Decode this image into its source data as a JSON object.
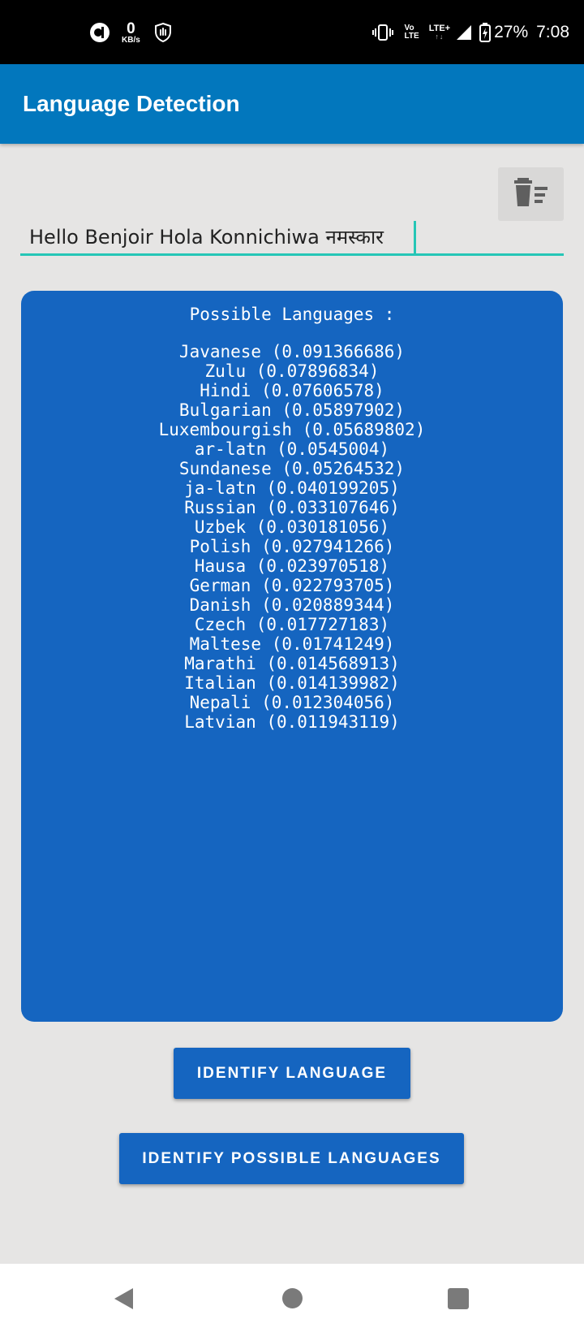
{
  "status_bar": {
    "data_speed_value": "0",
    "data_speed_unit": "KB/s",
    "volte_line1": "Vo",
    "volte_line2": "LTE",
    "network": "LTE+",
    "battery": "27%",
    "time": "7:08"
  },
  "app_bar": {
    "title": "Language Detection"
  },
  "input": {
    "value": "Hello Benjoir Hola Konnichiwa नमस्कार"
  },
  "results": {
    "heading": "Possible Languages :",
    "items": [
      "Javanese (0.091366686)",
      "Zulu (0.07896834)",
      "Hindi (0.07606578)",
      "Bulgarian (0.05897902)",
      "Luxembourgish (0.05689802)",
      "ar-latn (0.0545004)",
      "Sundanese (0.05264532)",
      "ja-latn (0.040199205)",
      "Russian (0.033107646)",
      "Uzbek (0.030181056)",
      "Polish (0.027941266)",
      "Hausa (0.023970518)",
      "German (0.022793705)",
      "Danish (0.020889344)",
      "Czech (0.017727183)",
      "Maltese (0.01741249)",
      "Marathi (0.014568913)",
      "Italian (0.014139982)",
      "Nepali (0.012304056)",
      "Latvian (0.011943119)"
    ]
  },
  "buttons": {
    "identify_language": "IDENTIFY LANGUAGE",
    "identify_possible": "IDENTIFY POSSIBLE LANGUAGES"
  },
  "icons": {
    "clear": "clear-all-icon",
    "back": "back-icon",
    "home": "home-icon",
    "recents": "recents-icon"
  },
  "colors": {
    "app_bar": "#0277bd",
    "panel": "#1565c0",
    "button": "#1565c0",
    "input_underline": "#26c6b6",
    "background": "#e6e5e4"
  }
}
